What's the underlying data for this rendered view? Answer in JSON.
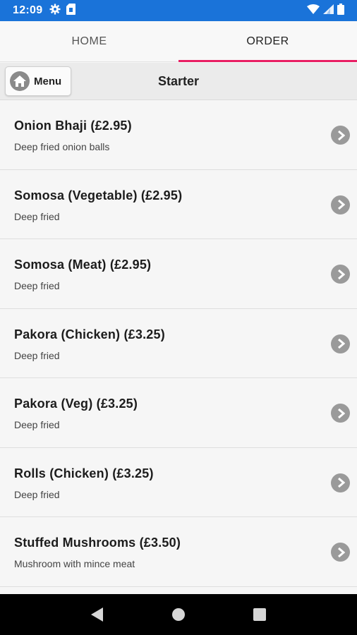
{
  "status_bar": {
    "time": "12:09",
    "icons": [
      "gear-icon",
      "sim-card-icon",
      "wifi-icon",
      "signal-icon",
      "battery-icon"
    ]
  },
  "tabs": [
    {
      "label": "HOME",
      "active": false
    },
    {
      "label": "ORDER",
      "active": true
    }
  ],
  "subheader": {
    "menu_button_label": "Menu",
    "title": "Starter"
  },
  "items": [
    {
      "name": "Onion Bhaji (£2.95)",
      "description": "Deep fried onion balls"
    },
    {
      "name": "Somosa (Vegetable) (£2.95)",
      "description": "Deep fried"
    },
    {
      "name": "Somosa (Meat) (£2.95)",
      "description": "Deep fried"
    },
    {
      "name": "Pakora (Chicken) (£3.25)",
      "description": "Deep fried"
    },
    {
      "name": "Pakora (Veg) (£3.25)",
      "description": "Deep fried"
    },
    {
      "name": "Rolls (Chicken) (£3.25)",
      "description": "Deep fried"
    },
    {
      "name": "Stuffed Mushrooms (£3.50)",
      "description": "Mushroom with mince meat"
    }
  ],
  "nav_bar": {
    "icons": [
      "back-icon",
      "home-icon",
      "recents-icon"
    ]
  },
  "colors": {
    "status_bar": "#1a73d9",
    "tab_indicator": "#e91e63",
    "chevron": "#9a9a9a"
  }
}
